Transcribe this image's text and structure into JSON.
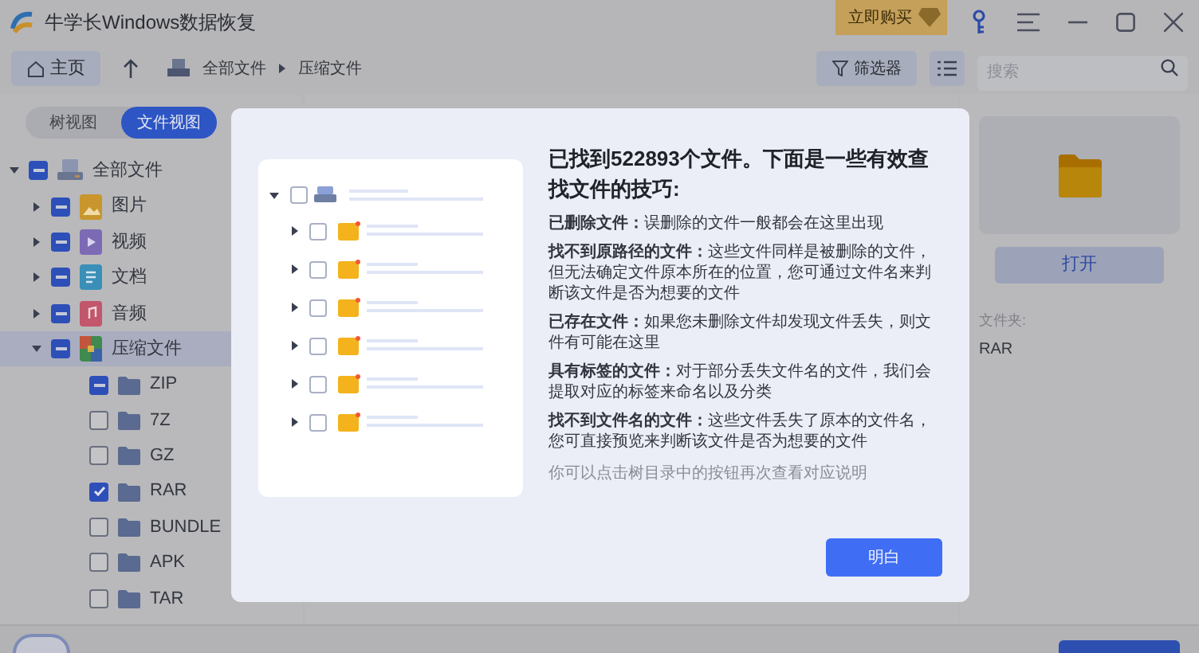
{
  "app": {
    "title": "牛学长Windows数据恢复",
    "buy_button": "立即购买"
  },
  "toolbar": {
    "home": "主页",
    "breadcrumb": [
      "全部文件",
      "压缩文件"
    ],
    "filter": "筛选器",
    "search": {
      "placeholder": "搜索"
    }
  },
  "view_tabs": [
    {
      "label": "树视图",
      "selected": false
    },
    {
      "label": "文件视图",
      "selected": true
    }
  ],
  "tree": [
    {
      "label": "全部文件",
      "kind": "drive",
      "checked": false,
      "partial": true,
      "expanded": true,
      "selected": false,
      "children": [
        {
          "label": "图片",
          "kind": "image",
          "checked": false,
          "partial": true,
          "expanded": false,
          "selected": false
        },
        {
          "label": "视频",
          "kind": "video",
          "checked": false,
          "partial": true,
          "expanded": false,
          "selected": false
        },
        {
          "label": "文档",
          "kind": "doc",
          "checked": false,
          "partial": true,
          "expanded": false,
          "selected": false
        },
        {
          "label": "音频",
          "kind": "audio",
          "checked": false,
          "partial": true,
          "expanded": false,
          "selected": false
        },
        {
          "label": "压缩文件",
          "kind": "archive",
          "checked": false,
          "partial": true,
          "expanded": true,
          "selected": true,
          "children": [
            {
              "label": "ZIP",
              "kind": "folder",
              "checked": false,
              "partial": true,
              "selected": false
            },
            {
              "label": "7Z",
              "kind": "folder",
              "checked": false,
              "partial": false,
              "selected": false
            },
            {
              "label": "GZ",
              "kind": "folder",
              "checked": false,
              "partial": false,
              "selected": false
            },
            {
              "label": "RAR",
              "kind": "folder",
              "checked": true,
              "partial": false,
              "selected": false
            },
            {
              "label": "BUNDLE",
              "kind": "folder",
              "checked": false,
              "partial": false,
              "selected": false
            },
            {
              "label": "APK",
              "kind": "folder",
              "checked": false,
              "partial": false,
              "selected": false
            },
            {
              "label": "TAR",
              "kind": "folder",
              "checked": false,
              "partial": false,
              "selected": false
            }
          ]
        }
      ]
    }
  ],
  "details": {
    "open_button": "打开",
    "type_label": "文件夹:",
    "name": "RAR"
  },
  "dialog": {
    "title": "已找到522893个文件。下面是一些有效查找文件的技巧:",
    "tips": [
      "**已删除文件：**误删除的文件一般都会在这里出现",
      "**找不到原路径的文件：**这些文件同样是被删除的文件，但无法确定文件原本所在的位置，您可通过文件名来判断该文件是否为想要的文件",
      "**已存在文件：**如果您未删除文件却发现文件丢失，则文件有可能在这里",
      "**具有标签的文件：**对于部分丢失文件名的文件，我们会提取对应的标签来命名以及分类",
      "**找不到文件名的文件：**这些文件丢失了原本的文件名，您可直接预览来判断该文件是否为想要的文件"
    ],
    "note": "你可以点击树目录中的按钮再次查看对应说明",
    "confirm": "明白"
  }
}
